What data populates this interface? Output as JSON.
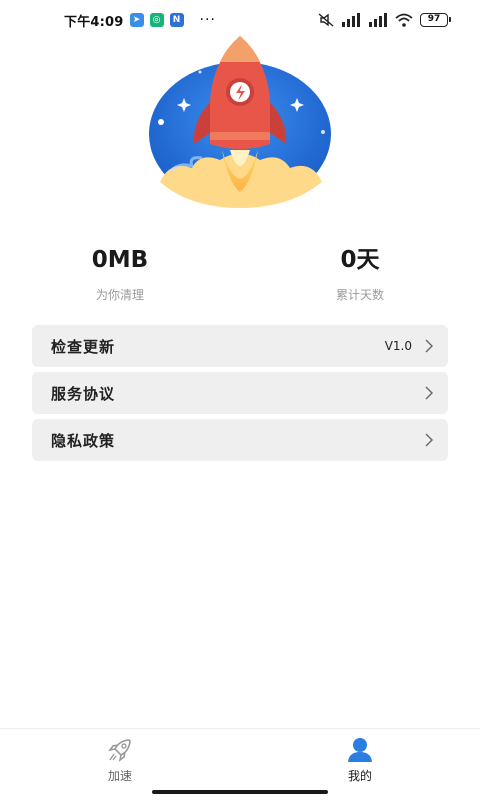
{
  "status_bar": {
    "time": "下午4:09",
    "more": "···",
    "battery": "97"
  },
  "stats": {
    "cleaned_value": "0MB",
    "cleaned_label": "为你清理",
    "days_value": "0天",
    "days_label": "累计天数"
  },
  "menu": {
    "items": [
      {
        "label": "检查更新",
        "value": "V1.0"
      },
      {
        "label": "服务协议",
        "value": ""
      },
      {
        "label": "隐私政策",
        "value": ""
      }
    ]
  },
  "bottom_nav": {
    "items": [
      {
        "label": "加速",
        "icon": "rocket-icon",
        "active": false
      },
      {
        "label": "我的",
        "icon": "person-icon",
        "active": true
      }
    ]
  },
  "colors": {
    "accent": "#2b7de0",
    "rocket": "#e8564a",
    "card_bg": "#efefef"
  }
}
